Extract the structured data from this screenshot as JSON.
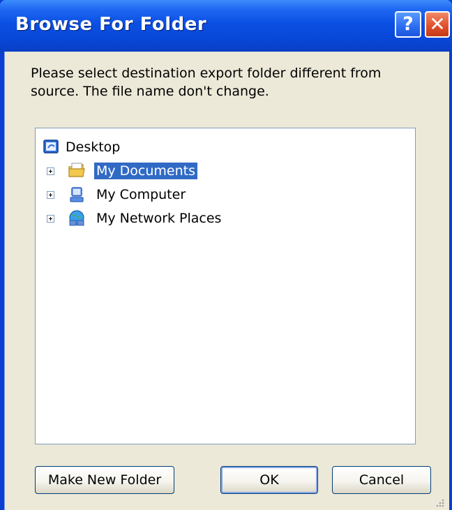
{
  "window": {
    "title": "Browse For Folder",
    "help_label": "?",
    "close_label": "✕"
  },
  "message": "Please select destination export folder different from source. The file name don't change.",
  "tree": {
    "root": {
      "label": "Desktop",
      "icon": "desktop-icon"
    },
    "items": [
      {
        "label": "My Documents",
        "icon": "my-documents-folder-icon",
        "selected": true
      },
      {
        "label": "My Computer",
        "icon": "my-computer-icon",
        "selected": false
      },
      {
        "label": "My Network Places",
        "icon": "network-places-icon",
        "selected": false
      }
    ]
  },
  "buttons": {
    "new_folder": "Make New Folder",
    "ok": "OK",
    "cancel": "Cancel"
  },
  "colors": {
    "titlebar": "#0b50e3",
    "selection": "#316ac5",
    "dialog_bg": "#ece9d8"
  }
}
